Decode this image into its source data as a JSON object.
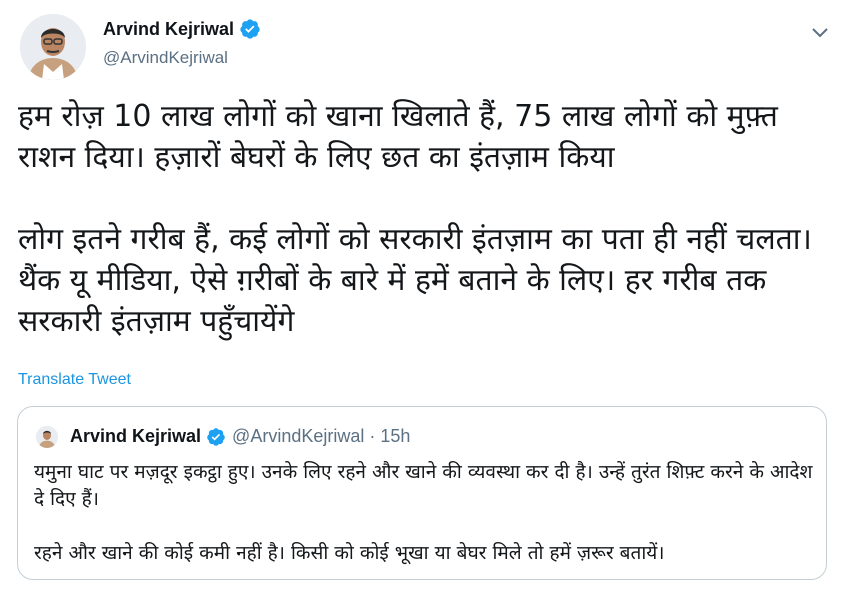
{
  "author": {
    "name": "Arvind Kejriwal",
    "handle": "@ArvindKejriwal"
  },
  "tweet": {
    "text": "हम रोज़ 10 लाख लोगों को खाना खिलाते हैं, 75 लाख लोगों को मुफ़्त राशन दिया। हज़ारों बेघरों के लिए छत का इंतज़ाम किया\n\nलोग इतने गरीब हैं, कई लोगों को सरकारी इंतज़ाम का पता ही नहीं चलता। थैंक यू मीडिया, ऐसे ग़रीबों के बारे में हमें बताने के लिए। हर गरीब तक सरकारी इंतज़ाम पहुँचायेंगे",
    "translate_label": "Translate Tweet"
  },
  "quoted_tweet": {
    "name": "Arvind Kejriwal",
    "handle": "@ArvindKejriwal",
    "separator": "·",
    "time": "15h",
    "text": "यमुना घाट पर मज़दूर इकट्ठा हुए। उनके लिए रहने और खाने की व्यवस्था कर दी है। उन्हें तुरंत शिफ़्ट करने के आदेश दे दिए हैं।\n\nरहने और खाने की कोई कमी नहीं है। किसी को कोई भूखा या बेघर मिले तो हमें ज़रूर बतायें।"
  },
  "colors": {
    "link": "#1b95e0",
    "verified": "#1da1f2",
    "secondary_text": "#5b7083",
    "border": "#c4cfd6"
  },
  "icons": {
    "verified": "verified-badge-icon",
    "more": "chevron-down-icon"
  }
}
